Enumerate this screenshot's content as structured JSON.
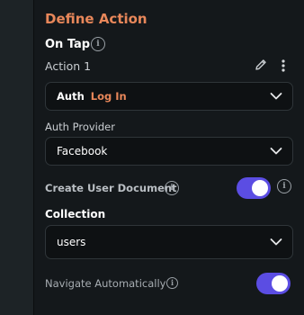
{
  "panel": {
    "title": "Define Action",
    "trigger_label": "On Tap",
    "action_label": "Action 1"
  },
  "action_select": {
    "category": "Auth",
    "value": "Log In"
  },
  "auth_provider": {
    "label": "Auth Provider",
    "value": "Facebook"
  },
  "create_user_document": {
    "label": "Create User Document",
    "enabled": true
  },
  "collection": {
    "label": "Collection",
    "value": "users"
  },
  "navigate_automatically": {
    "label": "Navigate Automatically",
    "enabled": true
  },
  "colors": {
    "accent": "#e8875a",
    "toggle_on": "#5b4de3",
    "background": "#14181b"
  },
  "icons": [
    "info-icon",
    "edit-icon",
    "more-vertical-icon",
    "chevron-down-icon"
  ]
}
